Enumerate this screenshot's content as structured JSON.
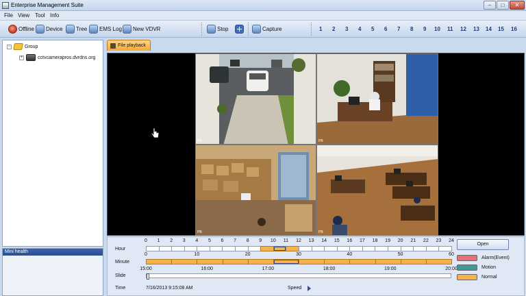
{
  "window": {
    "title": "Enterprise Management Suite",
    "minimize": "–",
    "maximize": "□",
    "close": "✕"
  },
  "menu": [
    "File",
    "View",
    "Tool",
    "Info"
  ],
  "toolbar": {
    "offline": "Offline",
    "device": "Device",
    "tree": "Tree",
    "ems_log": "EMS Log",
    "new_vdvr": "New VDVR",
    "stop": "Stop",
    "capture": "Capture",
    "channels": [
      "1",
      "2",
      "3",
      "4",
      "5",
      "6",
      "7",
      "8",
      "9",
      "10",
      "11",
      "12",
      "13",
      "14",
      "15",
      "16"
    ]
  },
  "tree": {
    "group": "Group",
    "device": "cctvcamerapros.dvrdns.org",
    "expander": "+"
  },
  "mini_health": {
    "title": "Mini health"
  },
  "tab": {
    "label": "File playback"
  },
  "cameras": [
    {
      "timestamp": "",
      "tag": "PB"
    },
    {
      "timestamp": "",
      "tag": "PB"
    },
    {
      "timestamp": "",
      "tag": "PB"
    },
    {
      "timestamp": "",
      "tag": "PB"
    }
  ],
  "controls": {
    "hour_label": "Hour",
    "minute_label": "Minute",
    "slide_label": "Slide",
    "time_label": "Time",
    "hour_scale": [
      "0",
      "1",
      "2",
      "3",
      "4",
      "5",
      "6",
      "7",
      "8",
      "9",
      "10",
      "11",
      "12",
      "13",
      "14",
      "15",
      "16",
      "17",
      "18",
      "19",
      "20",
      "21",
      "22",
      "23",
      "24"
    ],
    "minute_scale": [
      "0",
      "10",
      "20",
      "30",
      "40",
      "50",
      "60"
    ],
    "slide_scale": [
      "15:00",
      "16:00",
      "17:00",
      "18:00",
      "19:00",
      "20:00"
    ],
    "hour_normal_cells": [
      9,
      10,
      11
    ],
    "hour_selected_cell": 10,
    "minute_selected_cell": 5,
    "time_value": "7/16/2013 9:15:08 AM",
    "speed_label": "Speed",
    "slide_position": 0.0,
    "open_button": "Open",
    "legend": [
      {
        "label": "Alarm(Event)",
        "color": "#e8707a"
      },
      {
        "label": "Motion",
        "color": "#3f9a9a"
      },
      {
        "label": "Normal",
        "color": "#f6b24c"
      }
    ]
  }
}
